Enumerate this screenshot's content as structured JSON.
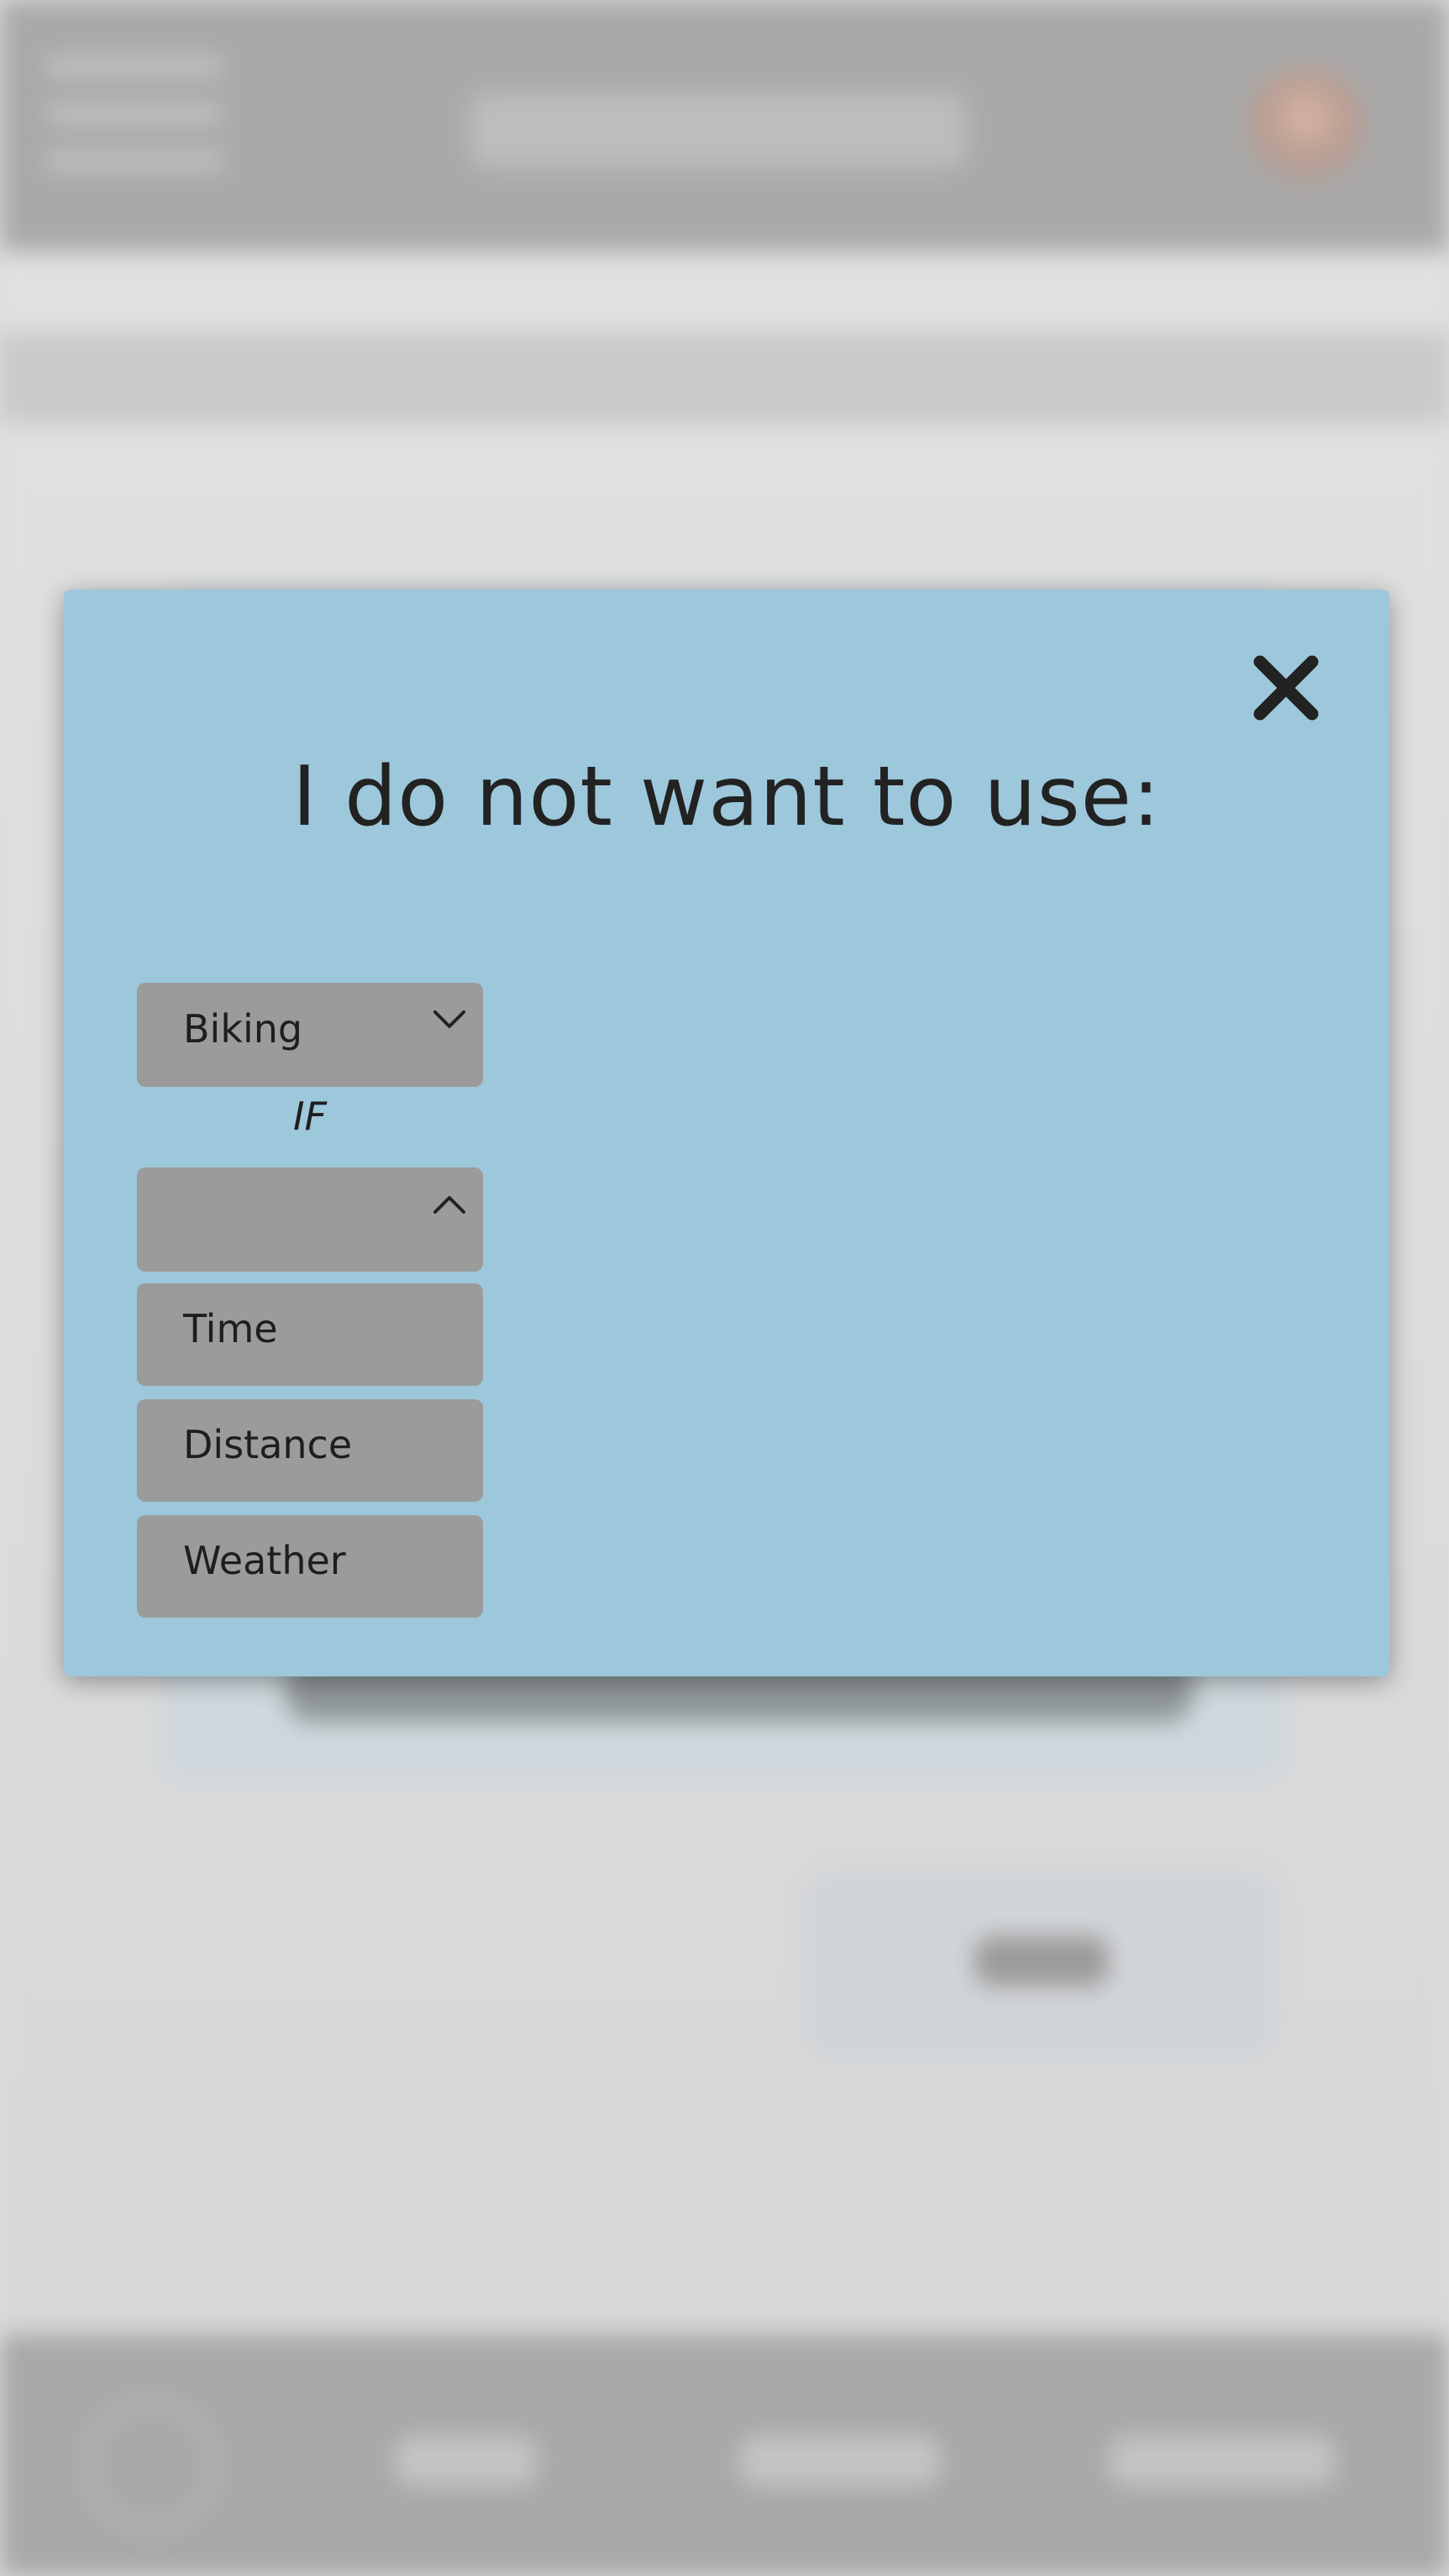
{
  "modal": {
    "title": "I do not want to use:",
    "activity_select": {
      "selected": "Biking"
    },
    "condition_keyword": "IF",
    "condition_select": {
      "selected": "",
      "options": [
        "Time",
        "Distance",
        "Weather"
      ]
    }
  },
  "colors": {
    "modal_background": "#9dc7db",
    "control_background": "#9b9b9b",
    "text": "#222222"
  },
  "icons": {
    "close": "close-icon",
    "activity_chevron": "chevron-down-icon",
    "condition_chevron": "chevron-up-icon"
  }
}
